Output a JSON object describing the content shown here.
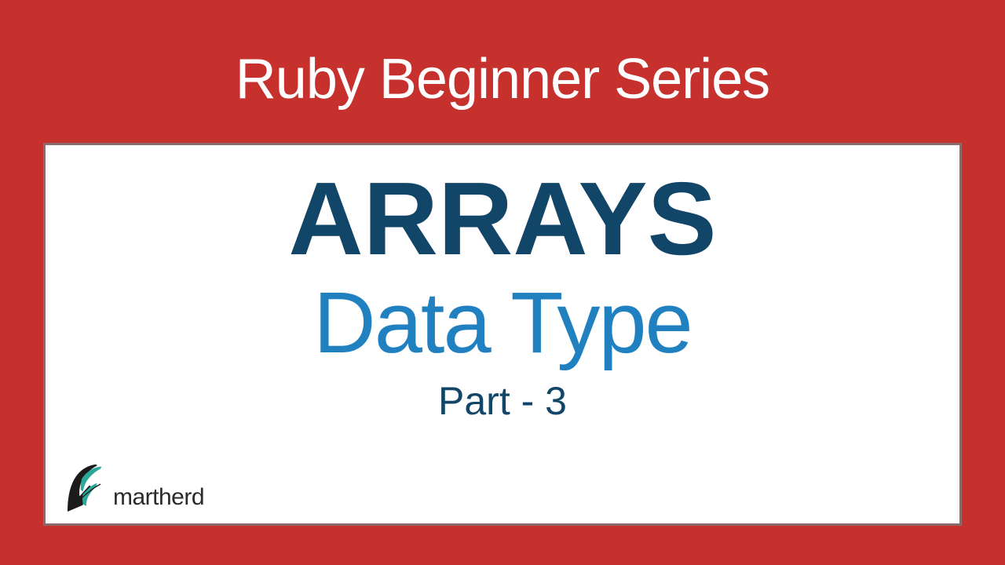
{
  "series": {
    "title": "Ruby Beginner Series"
  },
  "card": {
    "topic": "ARRAYS",
    "subtitle": "Data Type",
    "part": "Part - 3"
  },
  "brand": {
    "name": "martherd"
  }
}
